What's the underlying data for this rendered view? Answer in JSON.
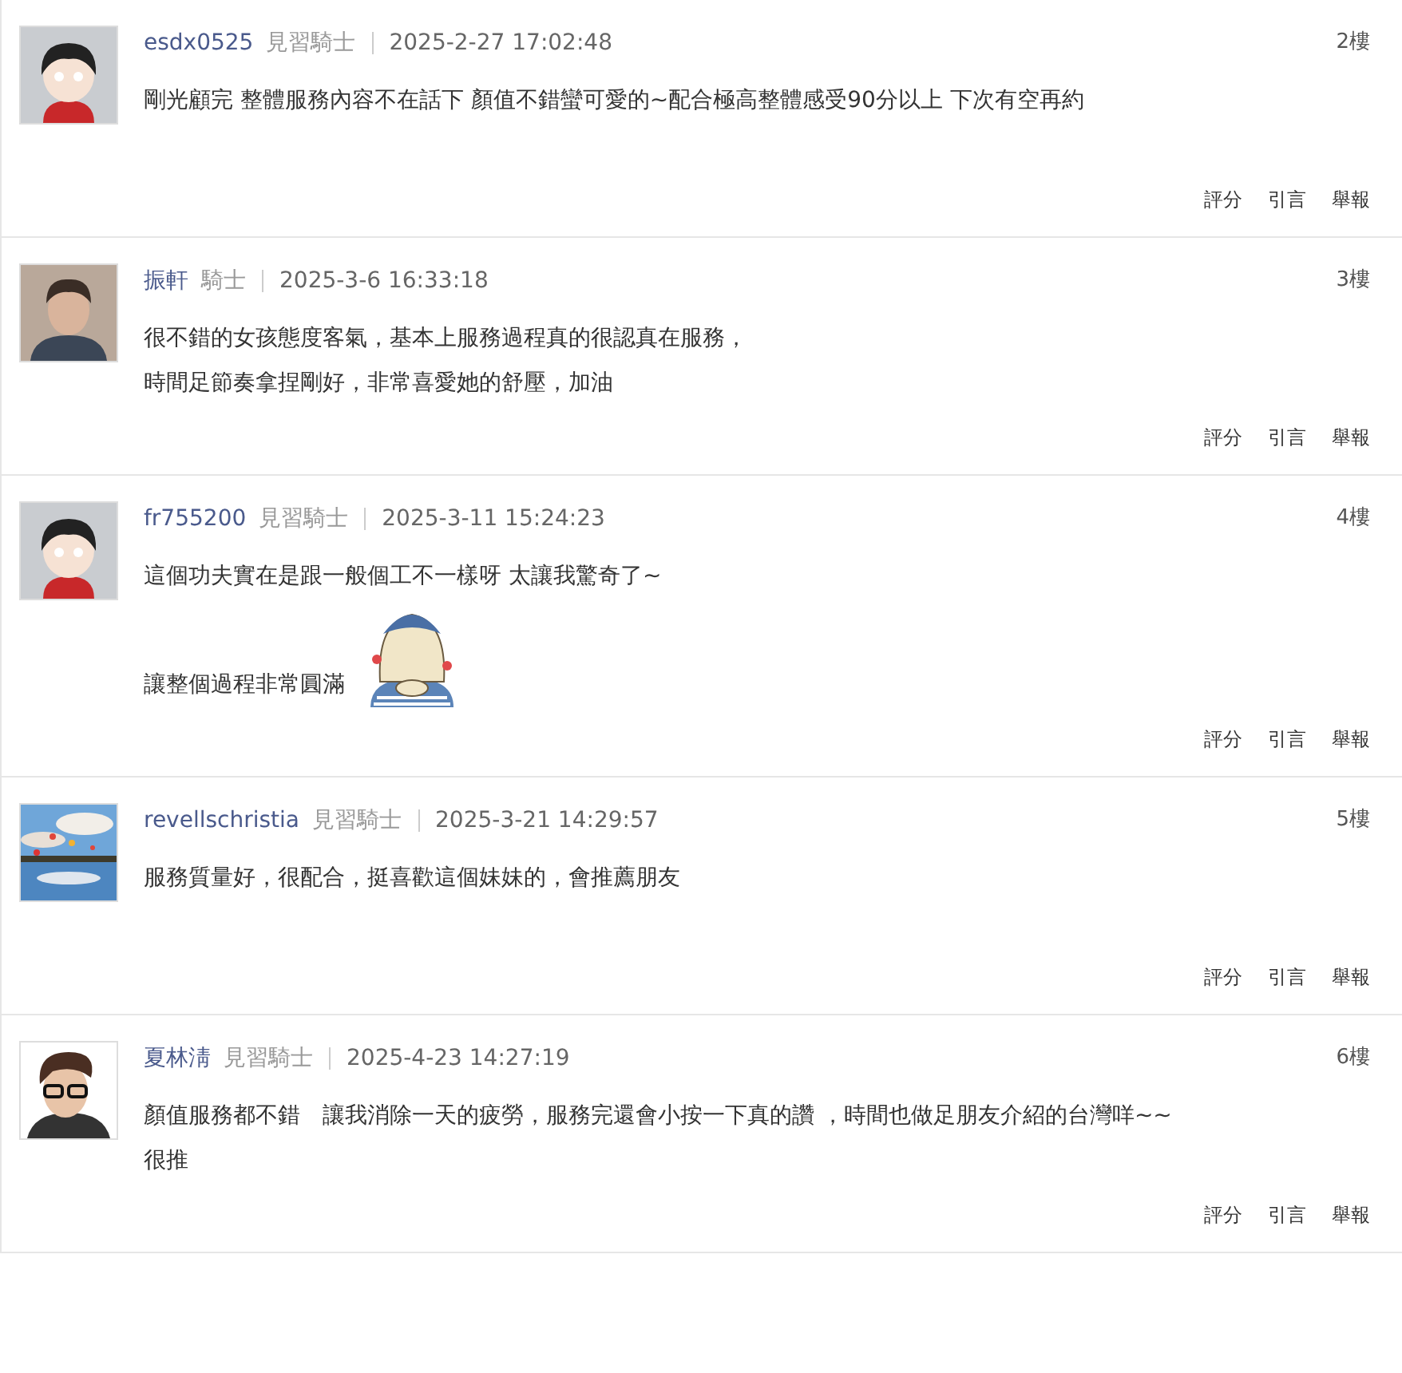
{
  "posts": [
    {
      "avatar": {
        "kind": "cartoon"
      },
      "author": "esdx0525",
      "rank": "見習騎士",
      "time": "2025-2-27 17:02:48",
      "floor": "2樓",
      "lines": [
        "剛光顧完 整體服務內容不在話下 顏值不錯蠻可愛的~配合極高整體感受90分以上 下次有空再約"
      ],
      "actions": [
        "評分",
        "引言",
        "舉報"
      ]
    },
    {
      "avatar": {
        "kind": "person"
      },
      "author": "振軒",
      "rank": "騎士",
      "time": "2025-3-6 16:33:18",
      "floor": "3樓",
      "lines": [
        "很不錯的女孩態度客氣，基本上服務過程真的很認真在服務，",
        "時間足節奏拿捏剛好，非常喜愛她的舒壓，加油"
      ],
      "actions": [
        "評分",
        "引言",
        "舉報"
      ]
    },
    {
      "avatar": {
        "kind": "cartoon"
      },
      "author": "fr755200",
      "rank": "見習騎士",
      "time": "2025-3-11 15:24:23",
      "floor": "4樓",
      "lines": [
        "這個功夫實在是跟一般個工不一樣呀 太讓我驚奇了~",
        "讓整個過程非常圓滿"
      ],
      "sticker": true,
      "actions": [
        "評分",
        "引言",
        "舉報"
      ]
    },
    {
      "avatar": {
        "kind": "picture"
      },
      "author": "revellschristia",
      "rank": "見習騎士",
      "time": "2025-3-21 14:29:57",
      "floor": "5樓",
      "lines": [
        "服務質量好，很配合，挺喜歡這個妹妹的，會推薦朋友"
      ],
      "actions": [
        "評分",
        "引言",
        "舉報"
      ]
    },
    {
      "avatar": {
        "kind": "illustrated"
      },
      "author": "夏林淸",
      "rank": "見習騎士",
      "time": "2025-4-23 14:27:19",
      "floor": "6樓",
      "lines": [
        "顏值服務都不錯　讓我消除一天的疲勞，服務完還會小按一下真的讚 ，時間也做足朋友介紹的台灣咩~~",
        "很推"
      ],
      "actions": [
        "評分",
        "引言",
        "舉報"
      ]
    }
  ]
}
